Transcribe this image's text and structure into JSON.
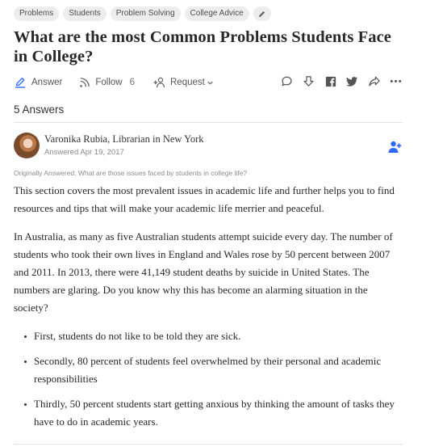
{
  "topics": [
    "Problems",
    "Students",
    "Problem Solving",
    "College Advice"
  ],
  "question": {
    "title": "What are the most Common Problems Students Face in College?"
  },
  "actions": {
    "answer_label": "Answer",
    "follow_label": "Follow",
    "follow_count": "6",
    "request_label": "Request"
  },
  "right_icons": [
    "comment-icon",
    "downvote-icon",
    "facebook-icon",
    "twitter-icon",
    "share-icon",
    "more-icon"
  ],
  "answers_count": "5 Answers",
  "answer": {
    "author": "Varonika Rubia, Librarian in New York",
    "answered": "Answered Apr 19, 2017",
    "originally_answered": "Originally Answered: What are those issues faced by students in college life?",
    "paragraphs": [
      "This section covers the most prevalent issues in academic life and further helps you to find resources and tips that will make your academic life merrier and peaceful.",
      "In Australia, as many as five Australian students attempt suicide every day. The number of students who took their own lives in England and Wales rose by 50 percent between 2007 and 2011. In 2013, there were 41,149 student deaths by suicide in United States. The numbers are glaring. Do you know why this has become an alarming situation in the society?"
    ],
    "bullets": [
      "First, students do not like to be told they are sick.",
      "Secondly, 80 percent of students feel overwhelmed by their personal and academic responsibilities",
      "Thirdly, 50 percent students start getting anxious by thinking the amount of tasks they have to do in academic years."
    ]
  },
  "colors": {
    "accent": "#2e69ff",
    "text": "#282829",
    "muted": "#888888"
  }
}
